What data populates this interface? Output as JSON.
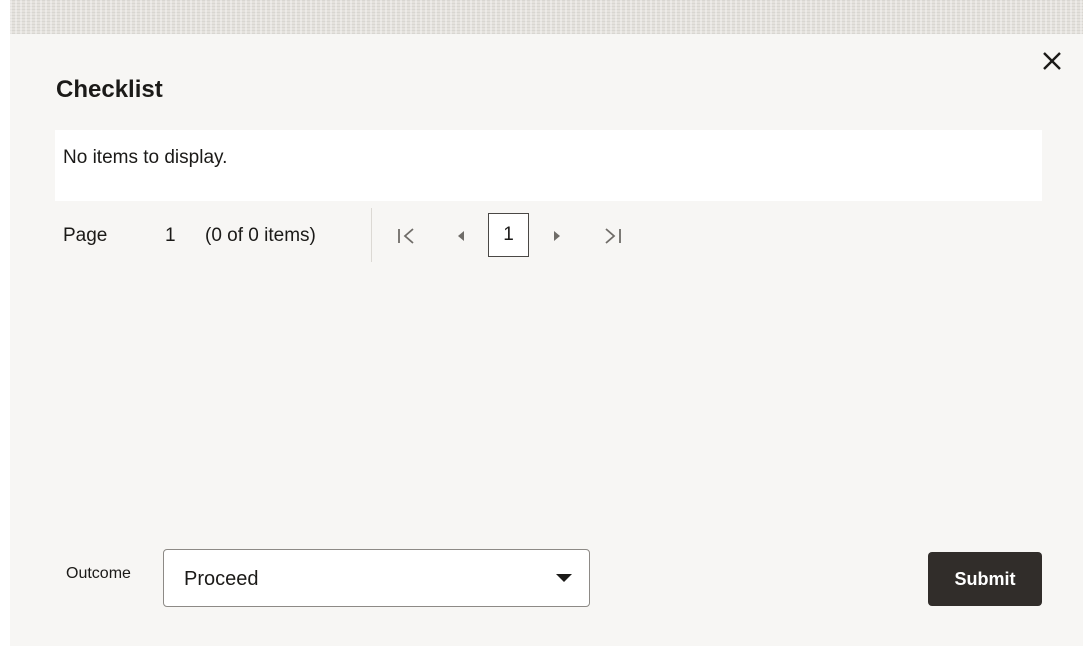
{
  "dialog": {
    "title": "Checklist",
    "close_icon": "close-icon"
  },
  "table": {
    "empty_message": "No items to display."
  },
  "pagination": {
    "page_label": "Page",
    "current_page": "1",
    "items_summary": "(0 of 0 items)",
    "page_button": "1",
    "icons": [
      "first-page-icon",
      "previous-page-icon",
      "next-page-icon",
      "last-page-icon"
    ]
  },
  "footer": {
    "outcome_label": "Outcome",
    "outcome_value": "Proceed",
    "submit_label": "Submit"
  },
  "colors": {
    "dialog_background": "#f7f6f4",
    "button_background": "#312d2a",
    "text": "#1b1a18"
  }
}
